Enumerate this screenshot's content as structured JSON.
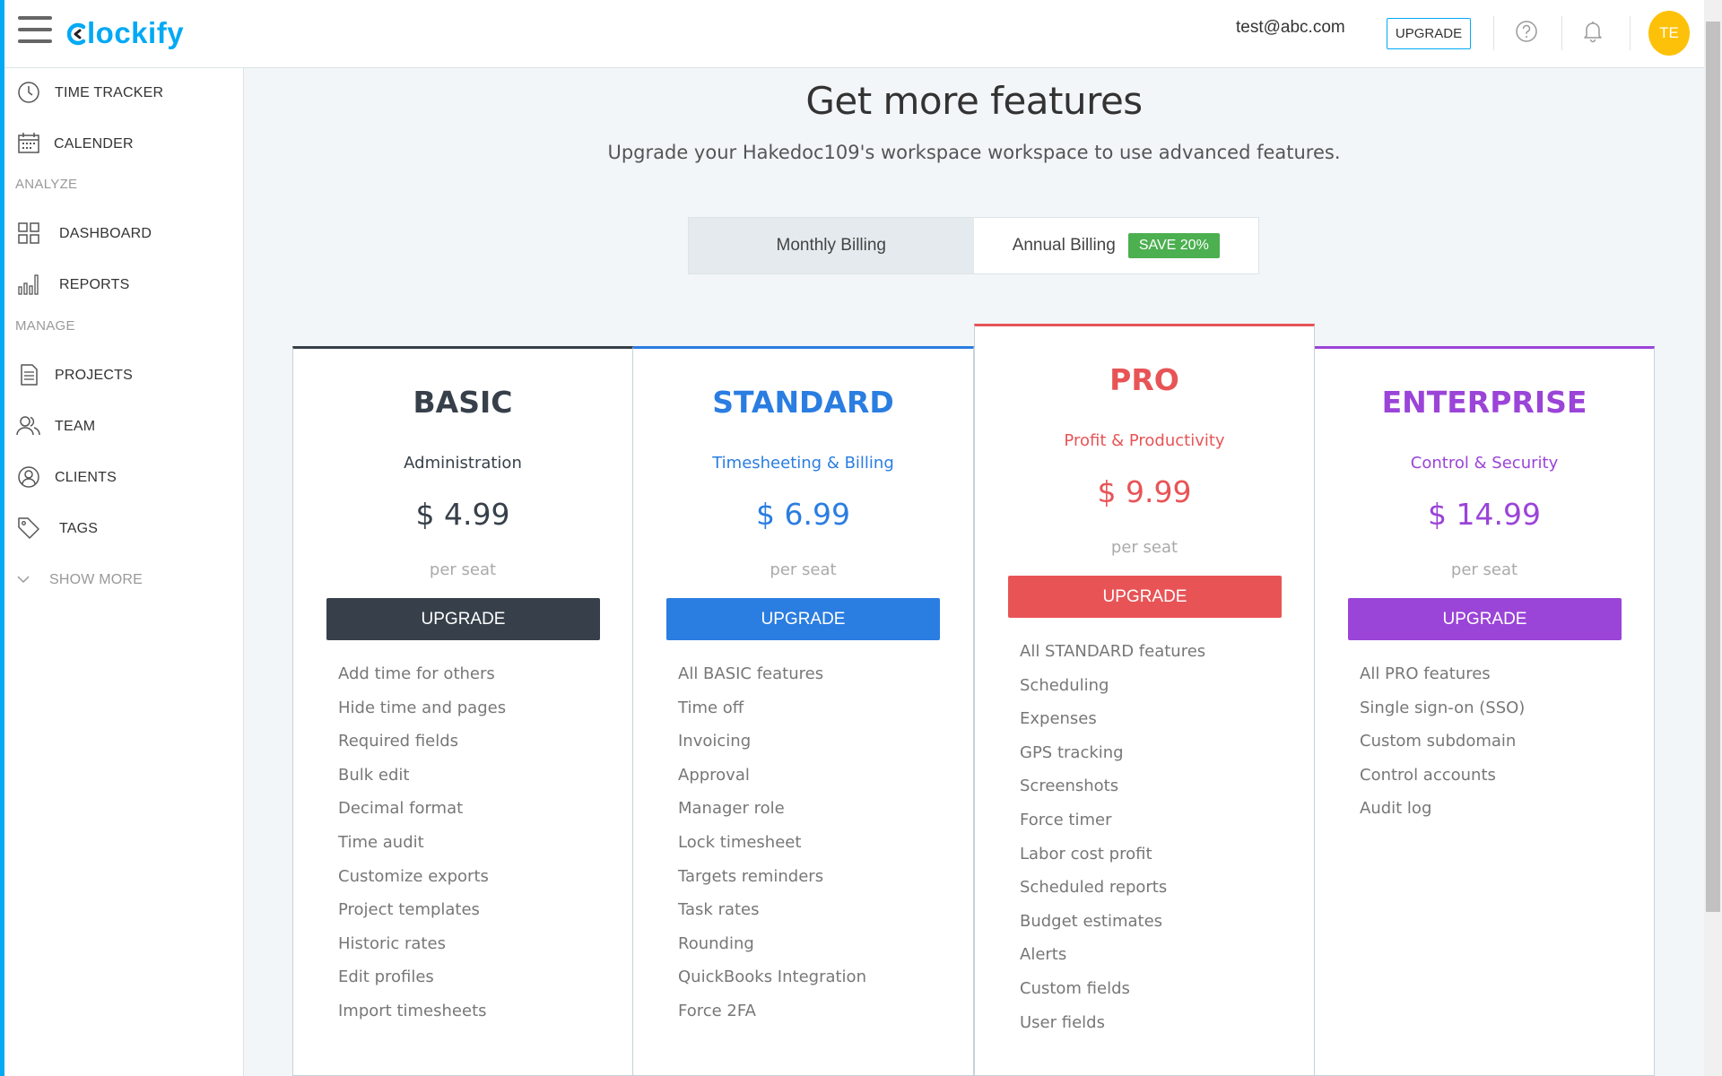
{
  "header": {
    "logo_text": "lockify",
    "email": "test@abc.com",
    "upgrade_label": "UPGRADE",
    "avatar_initials": "TE"
  },
  "sidebar": {
    "items": [
      {
        "label": "TIME TRACKER",
        "icon": "clock-icon"
      },
      {
        "label": "CALENDER",
        "icon": "calendar-icon"
      },
      {
        "label": "DASHBOARD",
        "icon": "dashboard-icon"
      },
      {
        "label": "REPORTS",
        "icon": "bar-chart-icon"
      },
      {
        "label": "PROJECTS",
        "icon": "document-icon"
      },
      {
        "label": "TEAM",
        "icon": "team-icon"
      },
      {
        "label": "CLIENTS",
        "icon": "client-icon"
      },
      {
        "label": "TAGS",
        "icon": "tag-icon"
      }
    ],
    "section_analyze": "ANALYZE",
    "section_manage": "MANAGE",
    "show_more": "SHOW MORE"
  },
  "main": {
    "title": "Get more features",
    "subtitle": "Upgrade your Hakedoc109's workspace workspace to use advanced features.",
    "billing": {
      "monthly": "Monthly Billing",
      "annual": "Annual Billing",
      "save_badge": "SAVE 20%"
    },
    "plans": [
      {
        "name": "BASIC",
        "tagline": "Administration",
        "price": "$ 4.99",
        "per": "per seat",
        "button": "UPGRADE",
        "color": "#37404a",
        "features": [
          "Add time for others",
          "Hide time and pages",
          "Required fields",
          "Bulk edit",
          "Decimal format",
          "Time audit",
          "Customize exports",
          "Project templates",
          "Historic rates",
          "Edit profiles",
          "Import timesheets"
        ]
      },
      {
        "name": "STANDARD",
        "tagline": "Timesheeting & Billing",
        "price": "$ 6.99",
        "per": "per seat",
        "button": "UPGRADE",
        "color": "#2a7de1",
        "features": [
          "All BASIC features",
          "Time off",
          "Invoicing",
          "Approval",
          "Manager role",
          "Lock timesheet",
          "Targets reminders",
          "Task rates",
          "Rounding",
          "QuickBooks Integration",
          "Force 2FA"
        ]
      },
      {
        "name": "PRO",
        "tagline": "Profit & Productivity",
        "price": "$ 9.99",
        "per": "per seat",
        "button": "UPGRADE",
        "color": "#e85456",
        "features": [
          "All STANDARD features",
          "Scheduling",
          "Expenses",
          "GPS tracking",
          "Screenshots",
          "Force timer",
          "Labor cost profit",
          "Scheduled reports",
          "Budget estimates",
          "Alerts",
          "Custom fields",
          "User fields"
        ]
      },
      {
        "name": "ENTERPRISE",
        "tagline": "Control & Security",
        "price": "$ 14.99",
        "per": "per seat",
        "button": "UPGRADE",
        "color": "#9b44d8",
        "features": [
          "All PRO features",
          "Single sign-on (SSO)",
          "Custom subdomain",
          "Control accounts",
          "Audit log"
        ]
      }
    ]
  }
}
